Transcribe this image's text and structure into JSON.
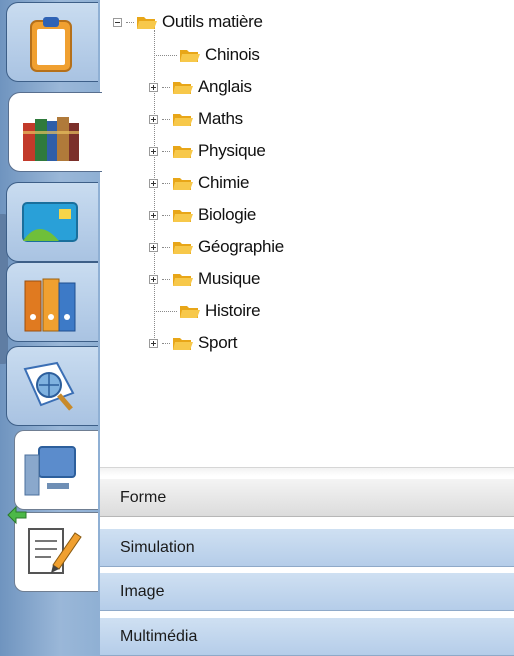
{
  "toolbar": {
    "tabs": [
      {
        "name": "clipboard",
        "icon": "clipboard-icon"
      },
      {
        "name": "books",
        "icon": "books-icon",
        "active": true
      },
      {
        "name": "card",
        "icon": "id-card-icon"
      },
      {
        "name": "binders",
        "icon": "binders-icon"
      },
      {
        "name": "search-globe",
        "icon": "globe-search-icon"
      },
      {
        "name": "computer",
        "icon": "computer-icon"
      },
      {
        "name": "notes",
        "icon": "notepad-pencil-icon"
      }
    ],
    "back_icon": "back-arrow-icon"
  },
  "tree": {
    "root": {
      "label": "Outils matière",
      "expanded": true
    },
    "children": [
      {
        "label": "Chinois",
        "expandable": false
      },
      {
        "label": "Anglais",
        "expandable": true
      },
      {
        "label": "Maths",
        "expandable": true
      },
      {
        "label": "Physique",
        "expandable": true
      },
      {
        "label": "Chimie",
        "expandable": true
      },
      {
        "label": "Biologie",
        "expandable": true
      },
      {
        "label": "Géographie",
        "expandable": true
      },
      {
        "label": "Musique",
        "expandable": true
      },
      {
        "label": "Histoire",
        "expandable": false
      },
      {
        "label": "Sport",
        "expandable": true
      }
    ]
  },
  "panels": [
    {
      "label": "Forme",
      "selected": true
    },
    {
      "label": "Simulation",
      "selected": false
    },
    {
      "label": "Image",
      "selected": false
    },
    {
      "label": "Multimédia",
      "selected": false
    }
  ],
  "colors": {
    "folder": "#f2b81e",
    "panel": "#c3d7ee",
    "sidebar": "#7fa3cc"
  }
}
